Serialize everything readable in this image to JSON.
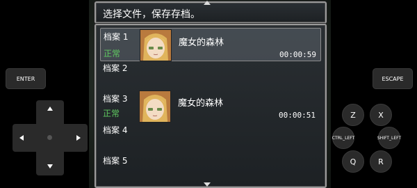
{
  "header": {
    "prompt": "选择文件，保存存档。"
  },
  "slots": [
    {
      "label": "档案 1",
      "status": "正常",
      "title": "魔女的森林",
      "time": "00:00:59",
      "selected": true
    },
    {
      "label": "档案 2"
    },
    {
      "label": "档案 3",
      "status": "正常",
      "title": "魔女的森林",
      "time": "00:00:51"
    },
    {
      "label": "档案 4"
    },
    {
      "label": "档案 5"
    }
  ],
  "controls": {
    "enter": "ENTER",
    "escape": "ESCAPE",
    "z": "Z",
    "x": "X",
    "ctrl_left": "CTRL_LEFT",
    "shift_left": "SHIFT_LEFT",
    "q": "Q",
    "r": "R"
  },
  "colors": {
    "status_ok": "#5fc860",
    "window_border": "#9a9a9a"
  }
}
